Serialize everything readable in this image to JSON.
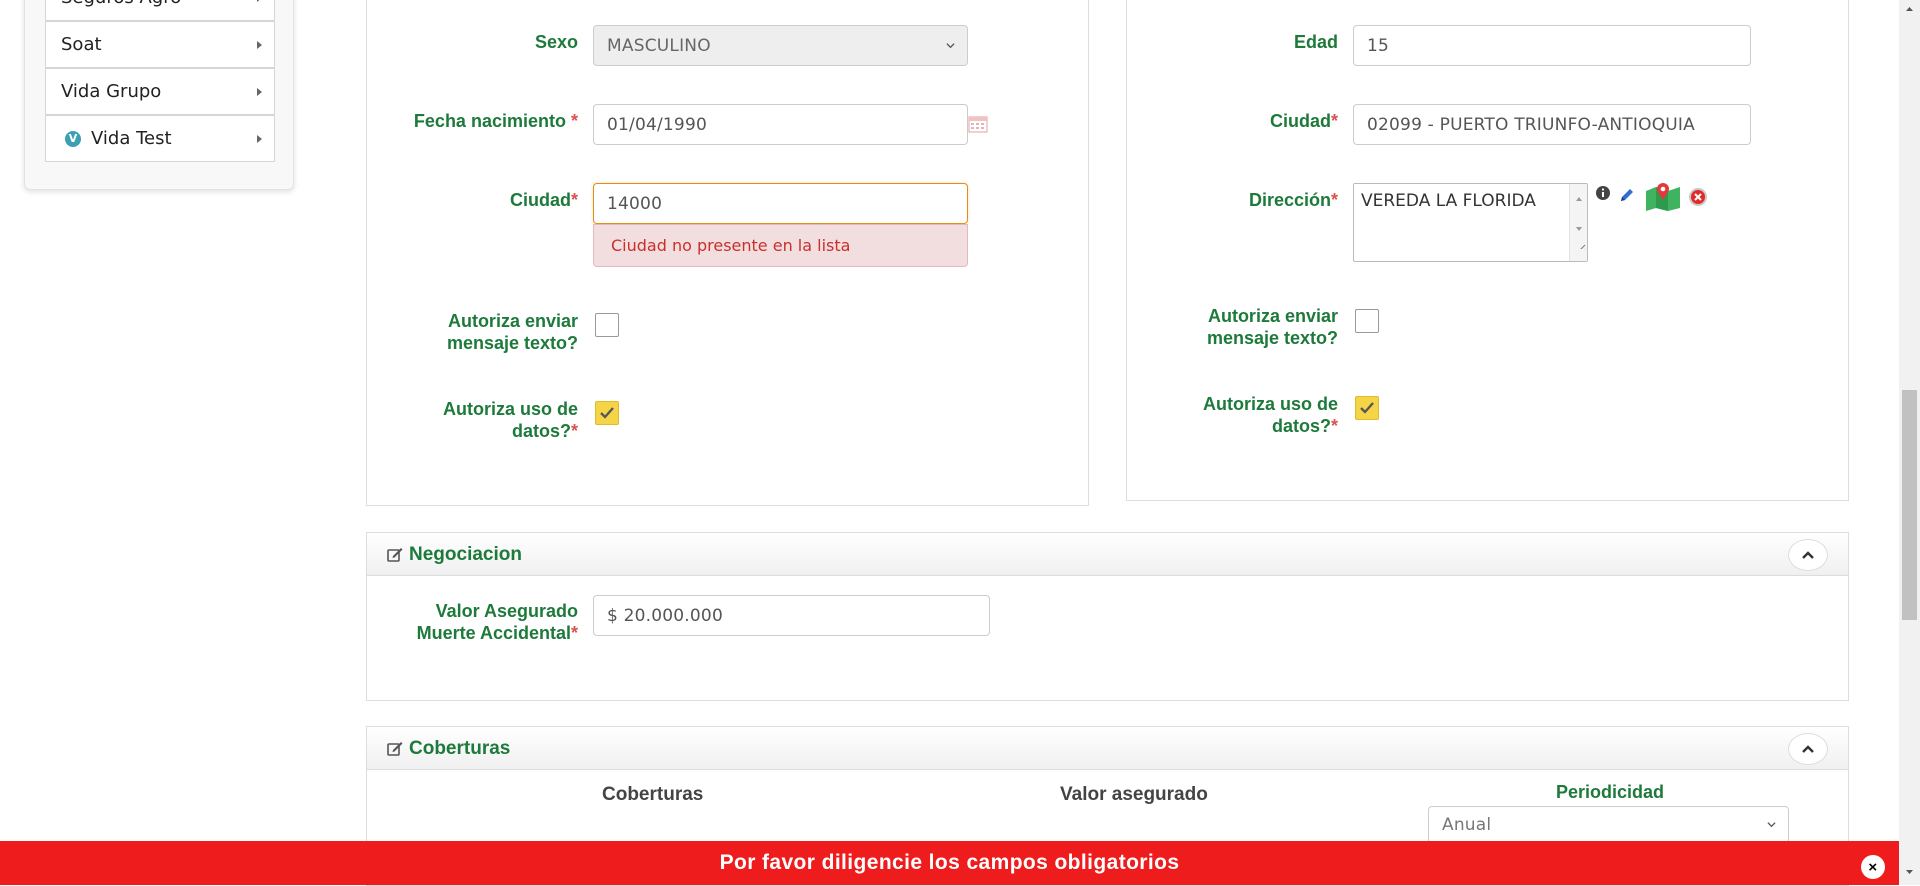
{
  "sidebar": {
    "items": [
      {
        "label": "Seguros Agro"
      },
      {
        "label": "Soat"
      },
      {
        "label": "Vida Grupo"
      },
      {
        "label": "Vida Test",
        "icon": "vida-test-logo-icon"
      }
    ]
  },
  "left_form": {
    "sexo": {
      "label": "Sexo",
      "value": "MASCULINO"
    },
    "fecha": {
      "label": "Fecha nacimiento",
      "required": "*",
      "value": "01/04/1990"
    },
    "ciudad": {
      "label": "Ciudad",
      "required": "*",
      "value": "14000",
      "error": "Ciudad no presente en la lista"
    },
    "sms": {
      "label_1": "Autoriza enviar",
      "label_2": "mensaje texto?",
      "checked": false
    },
    "datos": {
      "label_1": "Autoriza uso de",
      "label_2": "datos?",
      "required": "*",
      "checked": true
    }
  },
  "right_form": {
    "edad": {
      "label": "Edad",
      "value": "15"
    },
    "ciudad": {
      "label": "Ciudad",
      "required": "*",
      "value": "02099 - PUERTO TRIUNFO-ANTIOQUIA"
    },
    "direccion": {
      "label": "Dirección",
      "required": "*",
      "value": "VEREDA LA FLORIDA"
    },
    "sms": {
      "label_1": "Autoriza enviar",
      "label_2": "mensaje texto?",
      "checked": false
    },
    "datos": {
      "label_1": "Autoriza uso de",
      "label_2": "datos?",
      "required": "*",
      "checked": true
    }
  },
  "negociacion": {
    "title": "Negociacion",
    "valor": {
      "label_1": "Valor Asegurado",
      "label_2": "Muerte Accidental",
      "required": "*",
      "value": "$ 20.000.000"
    }
  },
  "coberturas": {
    "title": "Coberturas",
    "columns": {
      "coberturas": "Coberturas",
      "valor": "Valor asegurado",
      "periodicidad": "Periodicidad"
    },
    "periodicidad_value": "Anual"
  },
  "alert": {
    "message": "Por favor diligencie los campos obligatorios",
    "close": "×"
  },
  "colors": {
    "label_green": "#1d7a3a",
    "required_red": "#d9534f",
    "alert_red": "#ee1c1c",
    "check_yellow": "#f5d547"
  }
}
